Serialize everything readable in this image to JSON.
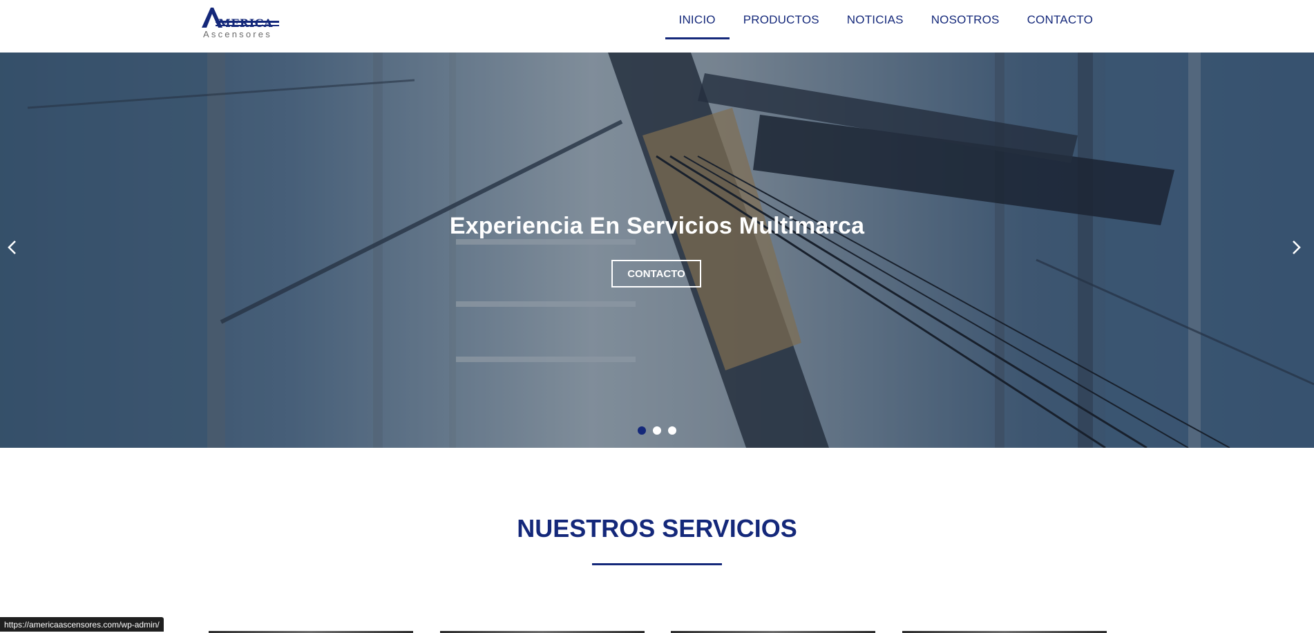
{
  "logo": {
    "word": "MERICA",
    "initial": "A",
    "sub": "Ascensores"
  },
  "nav": [
    {
      "label": "INICIO",
      "active": true
    },
    {
      "label": "PRODUCTOS",
      "active": false
    },
    {
      "label": "NOTICIAS",
      "active": false
    },
    {
      "label": "NOSOTROS",
      "active": false
    },
    {
      "label": "CONTACTO",
      "active": false
    }
  ],
  "hero": {
    "title": "Experiencia En Servicios Multimarca",
    "button": "CONTACTO",
    "slides_count": 3,
    "active_slide": 1
  },
  "section": {
    "title": "NUESTROS SERVICIOS"
  },
  "status_bar": {
    "url": "https://americaascensores.com/wp-admin/"
  },
  "colors": {
    "brand": "#14287a",
    "white": "#ffffff",
    "status_bg": "#1f1f1f"
  },
  "icons": {
    "prev": "chevron-left-icon",
    "next": "chevron-right-icon"
  }
}
